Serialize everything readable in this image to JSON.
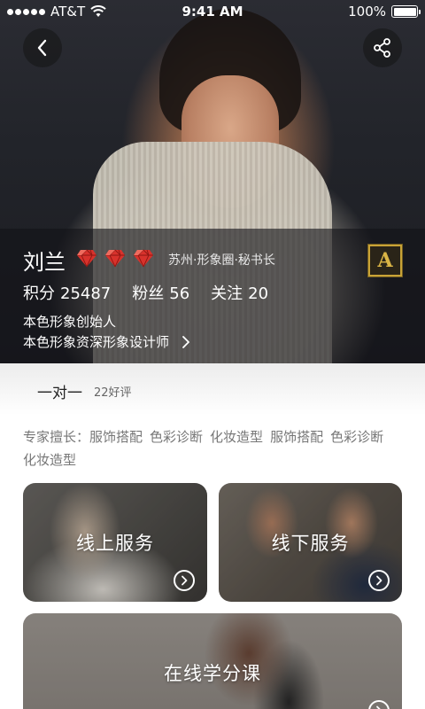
{
  "status_bar": {
    "carrier": "AT&T",
    "time": "9:41 AM",
    "battery": "100%"
  },
  "profile": {
    "name": "刘兰",
    "gem_count": 3,
    "tag": "苏州·形象圈·秘书长",
    "badge_letter": "A",
    "stats": [
      {
        "label": "积分",
        "value": "25487"
      },
      {
        "label": "粉丝",
        "value": "56"
      },
      {
        "label": "关注",
        "value": "20"
      }
    ],
    "title_lines": [
      "本色形象创始人",
      "本色形象资深形象设计师"
    ]
  },
  "tab": {
    "label": "一对一",
    "count": "22好评"
  },
  "expertise": {
    "label": "专家擅长：",
    "items": [
      "服饰搭配",
      "色彩诊断",
      "化妆造型",
      "服饰搭配",
      "色彩诊断",
      "化妆造型"
    ]
  },
  "cards": {
    "online": "线上服务",
    "offline": "线下服务",
    "course": "在线学分课"
  },
  "colors": {
    "gem": "#d8322c",
    "badge_gold": "#c9a336",
    "tab_bg": "#f2f2f2"
  }
}
